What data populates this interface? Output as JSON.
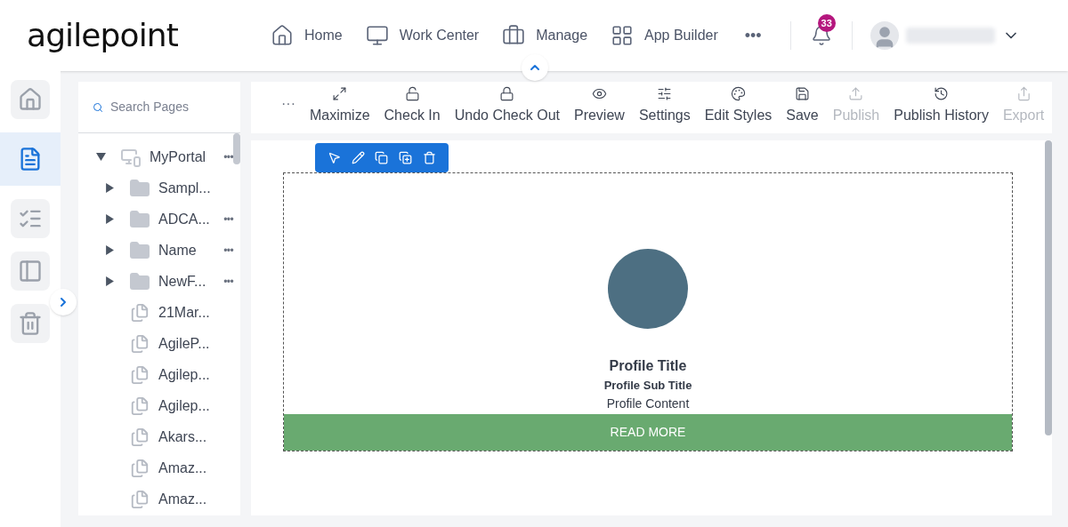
{
  "header": {
    "logo": "agilepoint",
    "nav": [
      {
        "label": "Home"
      },
      {
        "label": "Work Center"
      },
      {
        "label": "Manage"
      },
      {
        "label": "App Builder"
      }
    ],
    "more": "•••",
    "notifications": {
      "count": "33"
    }
  },
  "rail": [
    {
      "selected": false
    },
    {
      "selected": true
    },
    {
      "selected": false
    },
    {
      "selected": false
    },
    {
      "selected": false
    }
  ],
  "tree": {
    "search": {
      "placeholder": "Search Pages"
    },
    "items": [
      {
        "kind": "portal",
        "label": "MyPortal",
        "menu": "•••",
        "expanded": true,
        "children": [
          {
            "kind": "folder",
            "label": "Sampl...",
            "expanded": false
          },
          {
            "kind": "folder",
            "label": "ADCA...",
            "menu": "•••",
            "expanded": false
          },
          {
            "kind": "folder",
            "label": "Name",
            "menu": "•••",
            "expanded": false
          },
          {
            "kind": "folder",
            "label": "NewF...",
            "menu": "•••",
            "expanded": false
          },
          {
            "kind": "page",
            "label": "21Mar..."
          },
          {
            "kind": "page",
            "label": "AgileP..."
          },
          {
            "kind": "page",
            "label": "Agilep..."
          },
          {
            "kind": "page",
            "label": "Agilep..."
          },
          {
            "kind": "page",
            "label": "Akars..."
          },
          {
            "kind": "page",
            "label": "Amaz..."
          },
          {
            "kind": "page",
            "label": "Amaz..."
          }
        ]
      }
    ]
  },
  "toolbar": {
    "more": "···",
    "items": [
      {
        "label": "Maximize",
        "disabled": false
      },
      {
        "label": "Check In",
        "disabled": false
      },
      {
        "label": "Undo Check Out",
        "disabled": false
      },
      {
        "label": "Preview",
        "disabled": false
      },
      {
        "label": "Settings",
        "disabled": false
      },
      {
        "label": "Edit Styles",
        "disabled": false
      },
      {
        "label": "Save",
        "disabled": false
      },
      {
        "label": "Publish",
        "disabled": true
      },
      {
        "label": "Publish History",
        "disabled": false
      },
      {
        "label": "Export",
        "disabled": true
      }
    ]
  },
  "canvas": {
    "profile": {
      "title": "Profile Title",
      "subtitle": "Profile Sub Title",
      "content": "Profile Content",
      "button": "READ MORE"
    }
  }
}
